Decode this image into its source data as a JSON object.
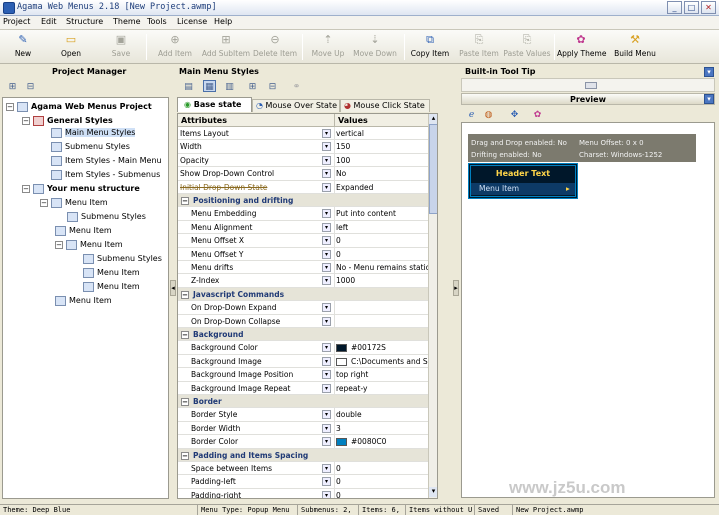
{
  "app": {
    "title": "Agama Web Menus 2.18 [New Project.awmp]",
    "buttons": {
      "min": "_",
      "max": "□",
      "close": "✕"
    }
  },
  "menubar": [
    "Project",
    "Edit",
    "Structure",
    "Theme",
    "Tools",
    "License",
    "Help"
  ],
  "toolbar": [
    {
      "label": "New",
      "icon": "new-file-icon",
      "glyph": "✎",
      "disabled": false
    },
    {
      "label": "Open",
      "icon": "open-folder-icon",
      "glyph": "▭",
      "disabled": false
    },
    {
      "label": "Save",
      "icon": "save-icon",
      "glyph": "▣",
      "disabled": true
    },
    {
      "label": "Add Item",
      "icon": "add-item-icon",
      "glyph": "⊕",
      "disabled": true
    },
    {
      "label": "Add SubItem",
      "icon": "add-subitem-icon",
      "glyph": "⊞",
      "disabled": true
    },
    {
      "label": "Delete Item",
      "icon": "delete-item-icon",
      "glyph": "⊖",
      "disabled": true
    },
    {
      "label": "Move Up",
      "icon": "move-up-icon",
      "glyph": "⇡",
      "disabled": true
    },
    {
      "label": "Move Down",
      "icon": "move-down-icon",
      "glyph": "⇣",
      "disabled": true
    },
    {
      "label": "Copy Item",
      "icon": "copy-item-icon",
      "glyph": "⧉",
      "disabled": false
    },
    {
      "label": "Paste Item",
      "icon": "paste-item-icon",
      "glyph": "⎘",
      "disabled": true
    },
    {
      "label": "Paste Values",
      "icon": "paste-values-icon",
      "glyph": "⎘",
      "disabled": true
    },
    {
      "label": "Apply Theme",
      "icon": "apply-theme-icon",
      "glyph": "✿",
      "disabled": false
    },
    {
      "label": "Build Menu",
      "icon": "build-menu-icon",
      "glyph": "⚒",
      "disabled": false
    }
  ],
  "left": {
    "title": "Project Manager",
    "tree": [
      {
        "label": "Agama Web Menus Project",
        "level": 0,
        "bold": true,
        "pm": "−",
        "icon": "project-icon"
      },
      {
        "label": "General Styles",
        "level": 1,
        "bold": true,
        "pm": "−",
        "icon": "styles-icon"
      },
      {
        "label": "Main Menu Styles",
        "level": 2,
        "sel": true,
        "icon": "style-page-icon"
      },
      {
        "label": "Submenu Styles",
        "level": 2,
        "icon": "style-page-icon"
      },
      {
        "label": "Item Styles - Main Menu",
        "level": 2,
        "icon": "style-page-icon"
      },
      {
        "label": "Item Styles - Submenus",
        "level": 2,
        "icon": "style-page-icon"
      },
      {
        "label": "Your menu structure",
        "level": 1,
        "bold": true,
        "pm": "−",
        "icon": "structure-icon"
      },
      {
        "label": "Menu Item",
        "level": 2,
        "pm": "−",
        "icon": "menu-item-icon"
      },
      {
        "label": "Submenu Styles",
        "level": 3,
        "icon": "submenu-styles-icon"
      },
      {
        "label": "Menu Item",
        "level": 3,
        "icon": "menu-item-icon"
      },
      {
        "label": "Menu Item",
        "level": 3,
        "pm": "−",
        "icon": "menu-item-icon"
      },
      {
        "label": "Submenu Styles",
        "level": 4,
        "icon": "submenu-styles-icon"
      },
      {
        "label": "Menu Item",
        "level": 4,
        "icon": "menu-item-icon"
      },
      {
        "label": "Menu Item",
        "level": 4,
        "icon": "menu-item-icon"
      },
      {
        "label": "Menu Item",
        "level": 3,
        "icon": "menu-item-icon"
      }
    ]
  },
  "center": {
    "title": "Main Menu Styles",
    "tabs": [
      "Base state",
      "Mouse Over State",
      "Mouse Click State"
    ],
    "columns": [
      "Attributes",
      "Values"
    ],
    "rows": [
      {
        "n": "Items Layout",
        "v": "vertical",
        "t": "r"
      },
      {
        "n": "Width",
        "v": "150",
        "t": "r"
      },
      {
        "n": "Opacity",
        "v": "100",
        "t": "r"
      },
      {
        "n": "Show Drop-Down Control",
        "v": "No",
        "t": "r"
      },
      {
        "n": "Initial Drop-Down State",
        "v": "Expanded",
        "t": "r",
        "strike": true
      },
      {
        "n": "Positioning and drifting",
        "t": "s"
      },
      {
        "n": "Menu Embedding",
        "v": "Put into content",
        "t": "i"
      },
      {
        "n": "Menu Alignment",
        "v": "left",
        "t": "i"
      },
      {
        "n": "Menu Offset X",
        "v": "0",
        "t": "i"
      },
      {
        "n": "Menu Offset Y",
        "v": "0",
        "t": "i"
      },
      {
        "n": "Menu drifts",
        "v": "No - Menu remains static",
        "t": "i"
      },
      {
        "n": "Z-Index",
        "v": "1000",
        "t": "i"
      },
      {
        "n": "Javascript Commands",
        "t": "s"
      },
      {
        "n": "On Drop-Down Expand",
        "v": "",
        "t": "i"
      },
      {
        "n": "On Drop-Down Collapse",
        "v": "",
        "t": "i"
      },
      {
        "n": "Background",
        "t": "s"
      },
      {
        "n": "Background Color",
        "v": "#00172S",
        "t": "i",
        "sw": "#00172a"
      },
      {
        "n": "Background Image",
        "v": "C:\\Documents and Settin",
        "t": "i",
        "sw": "#ffffff"
      },
      {
        "n": "Background Image Position",
        "v": "top right",
        "t": "i"
      },
      {
        "n": "Background Image Repeat",
        "v": "repeat-y",
        "t": "i"
      },
      {
        "n": "Border",
        "t": "s"
      },
      {
        "n": "Border Style",
        "v": "double",
        "t": "i"
      },
      {
        "n": "Border Width",
        "v": "3",
        "t": "i"
      },
      {
        "n": "Border Color",
        "v": "#0080C0",
        "t": "i",
        "sw": "#0080c0"
      },
      {
        "n": "Padding and Items Spacing",
        "t": "s"
      },
      {
        "n": "Space between Items",
        "v": "0",
        "t": "i"
      },
      {
        "n": "Padding-left",
        "v": "0",
        "t": "i"
      },
      {
        "n": "Padding-right",
        "v": "0",
        "t": "i"
      }
    ]
  },
  "right": {
    "tooltip_title": "Built-in Tool Tip",
    "preview_title": "Preview",
    "info": {
      "a": "Drag and Drop enabled: No",
      "b": "Menu Offset: 0 x 0",
      "c": "Drifting enabled: No",
      "d": "Charset: Windows-1252"
    },
    "menu": {
      "header": "Header Text",
      "item": "Menu Item"
    }
  },
  "watermark": "www.jz5u.com",
  "status": [
    "Theme: Deep Blue",
    "Menu Type: Popup Menu",
    "Submenus: 2,",
    "Items: 6,",
    "Items without U",
    "Saved",
    "New Project.awmp"
  ]
}
